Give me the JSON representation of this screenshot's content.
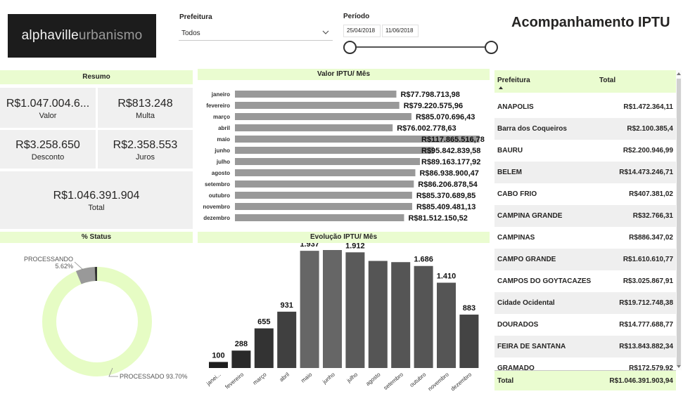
{
  "logo": {
    "part1": "alphaville",
    "part2": "urbanismo"
  },
  "title": "Acompanhamento IPTU",
  "filters": {
    "prefeitura_label": "Prefeitura",
    "prefeitura_value": "Todos",
    "periodo_label": "Período",
    "date_start": "25/04/2018",
    "date_end": "11/06/2018"
  },
  "resumo": {
    "header": "Resumo",
    "cards": [
      {
        "value": "R$1.047.004.6...",
        "label": "Valor"
      },
      {
        "value": "R$813.248",
        "label": "Multa"
      },
      {
        "value": "R$3.258.650",
        "label": "Desconto"
      },
      {
        "value": "R$2.358.553",
        "label": "Juros"
      },
      {
        "value": "R$1.046.391.904",
        "label": "Total"
      }
    ]
  },
  "status": {
    "header": "% Status",
    "processando_label": "PROCESSANDO",
    "processando_pct": "5.62%",
    "processado_label": "PROCESSADO 93.70%",
    "colors": {
      "processado": "#e6fcc4",
      "processando": "#999999",
      "other": "#333333"
    }
  },
  "table": {
    "col1": "Prefeitura",
    "col2": "Total",
    "rows": [
      {
        "name": "ANAPOLIS",
        "total": "R$1.472.364,11"
      },
      {
        "name": "Barra dos Coqueiros",
        "total": "R$2.100.385,4"
      },
      {
        "name": "BAURU",
        "total": "R$2.200.946,99"
      },
      {
        "name": "BELEM",
        "total": "R$14.473.246,71"
      },
      {
        "name": "CABO FRIO",
        "total": "R$407.381,02"
      },
      {
        "name": "CAMPINA GRANDE",
        "total": "R$32.766,31"
      },
      {
        "name": "CAMPINAS",
        "total": "R$886.347,02"
      },
      {
        "name": "CAMPO GRANDE",
        "total": "R$1.610.610,77"
      },
      {
        "name": "CAMPOS DO GOYTACAZES",
        "total": "R$3.025.867,91"
      },
      {
        "name": "Cidade Ocidental",
        "total": "R$19.712.748,38"
      },
      {
        "name": "DOURADOS",
        "total": "R$14.777.688,77"
      },
      {
        "name": "FEIRA DE SANTANA",
        "total": "R$13.843.882,34"
      },
      {
        "name": "GRAMADO",
        "total": "R$172.579,92"
      }
    ],
    "total_label": "Total",
    "total_value": "R$1.046.391.903,94"
  },
  "chart_data": [
    {
      "type": "bar",
      "orientation": "horizontal",
      "title": "Valor IPTU/ Mês",
      "categories": [
        "janeiro",
        "fevereiro",
        "março",
        "abril",
        "maio",
        "junho",
        "julho",
        "agosto",
        "setembro",
        "outubro",
        "novembro",
        "dezembro"
      ],
      "values": [
        77798713.98,
        79220575.96,
        85070696.43,
        76002778.63,
        117865516.78,
        95842839.58,
        89163177.92,
        86938900.47,
        86206878.54,
        85370689.85,
        85409481.13,
        81512150.52
      ],
      "labels": [
        "R$77.798.713,98",
        "R$79.220.575,96",
        "R$85.070.696,43",
        "R$76.002.778,63",
        "R$117.865.516,78",
        "R$95.842.839,58",
        "R$89.163.177,92",
        "R$86.938.900,47",
        "R$86.206.878,54",
        "R$85.370.689,85",
        "R$85.409.481,13",
        "R$81.512.150,52"
      ],
      "color": "#999999"
    },
    {
      "type": "bar",
      "title": "Evolução IPTU/ Mês",
      "categories": [
        "janei...",
        "fevereiro",
        "março",
        "abril",
        "maio",
        "junho",
        "julho",
        "agosto",
        "setembro",
        "outubro",
        "novembro",
        "dezembro"
      ],
      "values": [
        100,
        288,
        655,
        931,
        1937,
        1950,
        1912,
        1770,
        1750,
        1686,
        1410,
        883
      ],
      "labels": [
        "100",
        "288",
        "655",
        "931",
        "1.937",
        "",
        "1.912",
        "",
        "",
        "1.686",
        "1.410",
        "883"
      ],
      "colors": [
        "#1e1e1e",
        "#2a2a2a",
        "#333333",
        "#404040",
        "#666666",
        "#666666",
        "#5a5a5a",
        "#555555",
        "#555555",
        "#555555",
        "#555555",
        "#444444"
      ]
    }
  ]
}
